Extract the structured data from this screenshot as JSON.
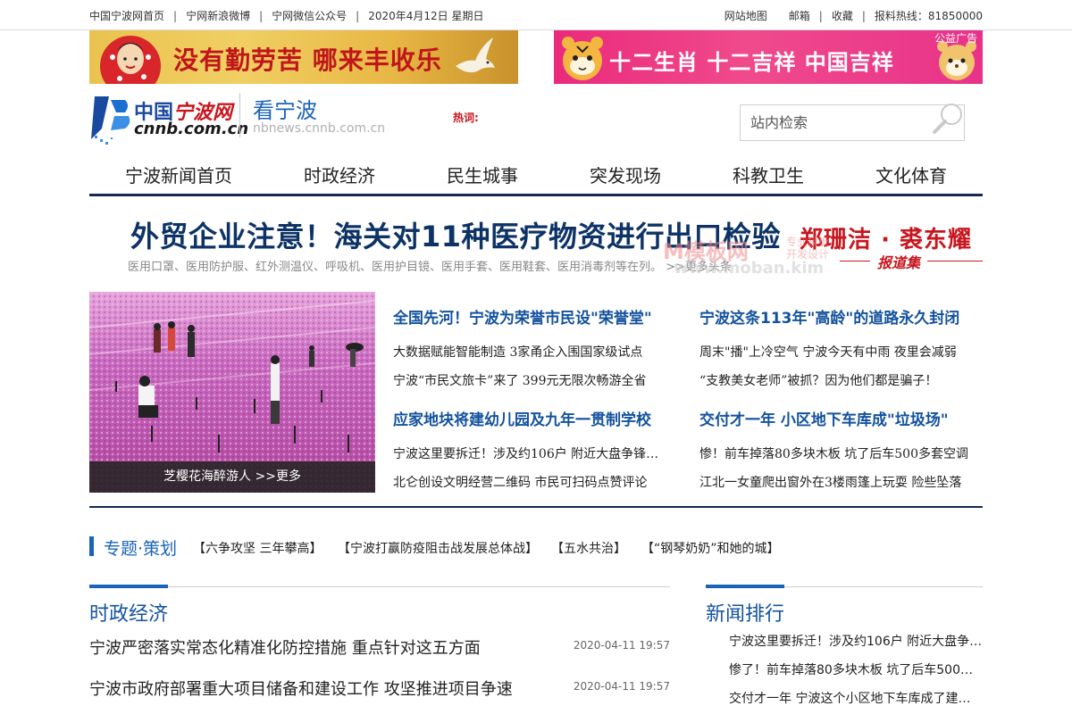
{
  "topbar": {
    "left_links": [
      "中国宁波网首页",
      "宁网新浪微博",
      "宁网微信公众号"
    ],
    "date": "2020年4月12日 星期日",
    "right_links": [
      "网站地图",
      "邮箱",
      "收藏"
    ],
    "hotline": "报料热线：81850000",
    "separator": "|"
  },
  "ads": {
    "left_slogan": "没有勤劳苦 哪来丰收乐",
    "right_slogan": "十二生肖 十二吉祥 中国吉祥",
    "right_tag": "公益广告"
  },
  "header": {
    "logo_cn": "中国",
    "logo_cn_red": "宁波网",
    "logo_domain": "cnnb.com.cn",
    "channel_title": "看宁波",
    "channel_domain": "nbnews.cnnb.com.cn",
    "hotwords_label": "热词:",
    "search_placeholder": "站内检索"
  },
  "nav": {
    "items": [
      "宁波新闻首页",
      "时政经济",
      "民生城事",
      "突发现场",
      "科教卫生",
      "文化体育"
    ]
  },
  "headline": {
    "title": "外贸企业注意！海关对11种医疗物资进行出口检验",
    "summary": "医用口罩、医用防护服、红外测温仪、呼吸机、医用护目镜、医用手套、医用鞋套、医用消毒剂等在列。 >>更多头条",
    "author_names": "郑珊洁 · 裘东耀",
    "author_collection": "报道集"
  },
  "watermark": {
    "brand": "M模板网",
    "tagline_1": "专业模板",
    "tagline_2": "开发设计",
    "url": "www.moban.kim"
  },
  "photo": {
    "caption": "芝樱花海醉游人  >>更多"
  },
  "stories": {
    "left": [
      {
        "title": "全国先河！宁波为荣誉市民设\"荣誉堂\"",
        "lines": [
          "大数据赋能智能制造 3家甬企入围国家级试点",
          "宁波“市民文旅卡”来了 399元无限次畅游全省"
        ]
      },
      {
        "title": "应家地块将建幼儿园及九年一贯制学校",
        "lines": [
          "宁波这里要拆迁！涉及约106户 附近大盘争锋…",
          "北仑创设文明经营二维码 市民可扫码点赞评论"
        ]
      }
    ],
    "right": [
      {
        "title": "宁波这条113年\"高龄\"的道路永久封闭",
        "lines": [
          "周末\"播\"上冷空气 宁波今天有中雨 夜里会减弱",
          "“支教美女老师”被抓？因为他们都是骗子！"
        ]
      },
      {
        "title": "交付才一年 小区地下车库成\"垃圾场\"",
        "lines": [
          "惨！前车掉落80多块木板 坑了后车500多套空调",
          "江北一女童爬出窗外在3楼雨篷上玩耍 险些坠落"
        ]
      }
    ]
  },
  "topics": {
    "title": "专题·策划",
    "items": [
      "【六争攻坚 三年攀高】",
      "【宁波打赢防疫阻击战发展总体战】",
      "【五水共治】",
      "【“钢琴奶奶”和她的城】"
    ]
  },
  "politics": {
    "title": "时政经济",
    "rows": [
      {
        "title": "宁波严密落实常态化精准化防控措施 重点针对这五方面",
        "date": "2020-04-11 19:57"
      },
      {
        "title": "宁波市政府部署重大项目储备和建设工作 攻坚推进项目争速",
        "date": "2020-04-11 19:57"
      }
    ]
  },
  "ranking": {
    "title": "新闻排行",
    "items": [
      "宁波这里要拆迁！涉及约106户 附近大盘争…",
      "惨了！前车掉落80多块木板 坑了后车500…",
      "交付才一年 宁波这个小区地下车库成了建…"
    ]
  },
  "colors": {
    "brand_blue": "#13529e",
    "nav_rule": "#15294a",
    "accent_red": "#c8161e"
  }
}
